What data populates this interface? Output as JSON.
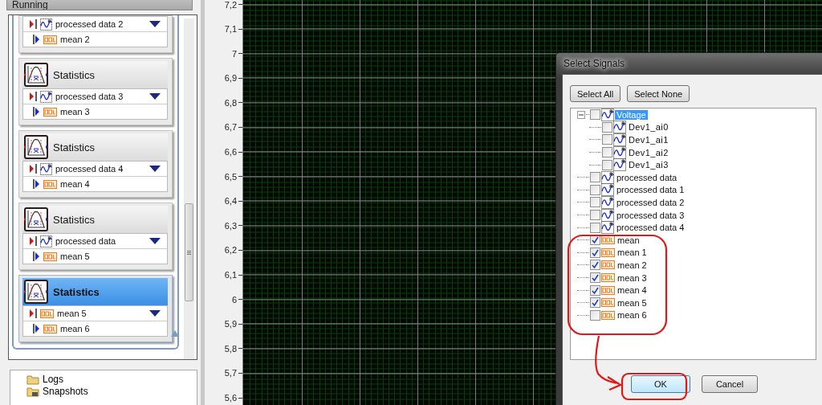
{
  "left_panel": {
    "status": "Running",
    "steps": [
      {
        "selected": false,
        "input": {
          "kind": "wave",
          "text": "processed data 2"
        },
        "output": {
          "kind": "dbl",
          "text": "mean 2"
        }
      },
      {
        "title": "Statistics",
        "selected": false,
        "input": {
          "kind": "wave",
          "text": "processed data 3"
        },
        "output": {
          "kind": "dbl",
          "text": "mean 3"
        }
      },
      {
        "title": "Statistics",
        "selected": false,
        "input": {
          "kind": "wave",
          "text": "processed data 4"
        },
        "output": {
          "kind": "dbl",
          "text": "mean 4"
        }
      },
      {
        "title": "Statistics",
        "selected": false,
        "input": {
          "kind": "wave",
          "text": "processed data"
        },
        "output": {
          "kind": "dbl",
          "text": "mean 5"
        }
      },
      {
        "title": "Statistics",
        "selected": true,
        "input": {
          "kind": "dbl",
          "text": "mean 5"
        },
        "output": {
          "kind": "dbl",
          "text": "mean 6"
        }
      }
    ],
    "bottom_tree": [
      {
        "kind": "folder",
        "label": "Logs"
      },
      {
        "kind": "snapshot",
        "label": "Snapshots"
      }
    ]
  },
  "graph": {
    "y_ticks": [
      "7,2",
      "7,1",
      "7",
      "6,9",
      "6,8",
      "6,7",
      "6,6",
      "6,5",
      "6,4",
      "6,3",
      "6,2",
      "6,1",
      "6",
      "5,9",
      "5,8",
      "5,7",
      "5,6"
    ]
  },
  "dialog": {
    "title": "Select Signals",
    "top_buttons": [
      "Select All",
      "Select None"
    ],
    "tree": [
      {
        "label": "Voltage",
        "kind": "wave",
        "checked": false,
        "selected": true,
        "expanded": true,
        "children": [
          {
            "label": "Dev1_ai0",
            "kind": "wave",
            "checked": false,
            "selected": false
          },
          {
            "label": "Dev1_ai1",
            "kind": "wave",
            "checked": false,
            "selected": false
          },
          {
            "label": "Dev1_ai2",
            "kind": "wave",
            "checked": false,
            "selected": false
          },
          {
            "label": "Dev1_ai3",
            "kind": "wave",
            "checked": false,
            "selected": false
          }
        ]
      },
      {
        "label": "processed data",
        "kind": "wave",
        "checked": false,
        "selected": false
      },
      {
        "label": "processed data 1",
        "kind": "wave",
        "checked": false,
        "selected": false
      },
      {
        "label": "processed data 2",
        "kind": "wave",
        "checked": false,
        "selected": false
      },
      {
        "label": "processed data 3",
        "kind": "wave",
        "checked": false,
        "selected": false
      },
      {
        "label": "processed data 4",
        "kind": "wave",
        "checked": false,
        "selected": false
      },
      {
        "label": "mean",
        "kind": "dbl",
        "checked": true,
        "selected": false
      },
      {
        "label": "mean 1",
        "kind": "dbl",
        "checked": true,
        "selected": false
      },
      {
        "label": "mean 2",
        "kind": "dbl",
        "checked": true,
        "selected": false
      },
      {
        "label": "mean 3",
        "kind": "dbl",
        "checked": true,
        "selected": false
      },
      {
        "label": "mean 4",
        "kind": "dbl",
        "checked": true,
        "selected": false
      },
      {
        "label": "mean 5",
        "kind": "dbl",
        "checked": true,
        "selected": false
      },
      {
        "label": "mean 6",
        "kind": "dbl",
        "checked": false,
        "selected": false
      }
    ],
    "bottom_buttons": [
      {
        "label": "OK",
        "default": true
      },
      {
        "label": "Cancel",
        "default": false
      }
    ]
  }
}
